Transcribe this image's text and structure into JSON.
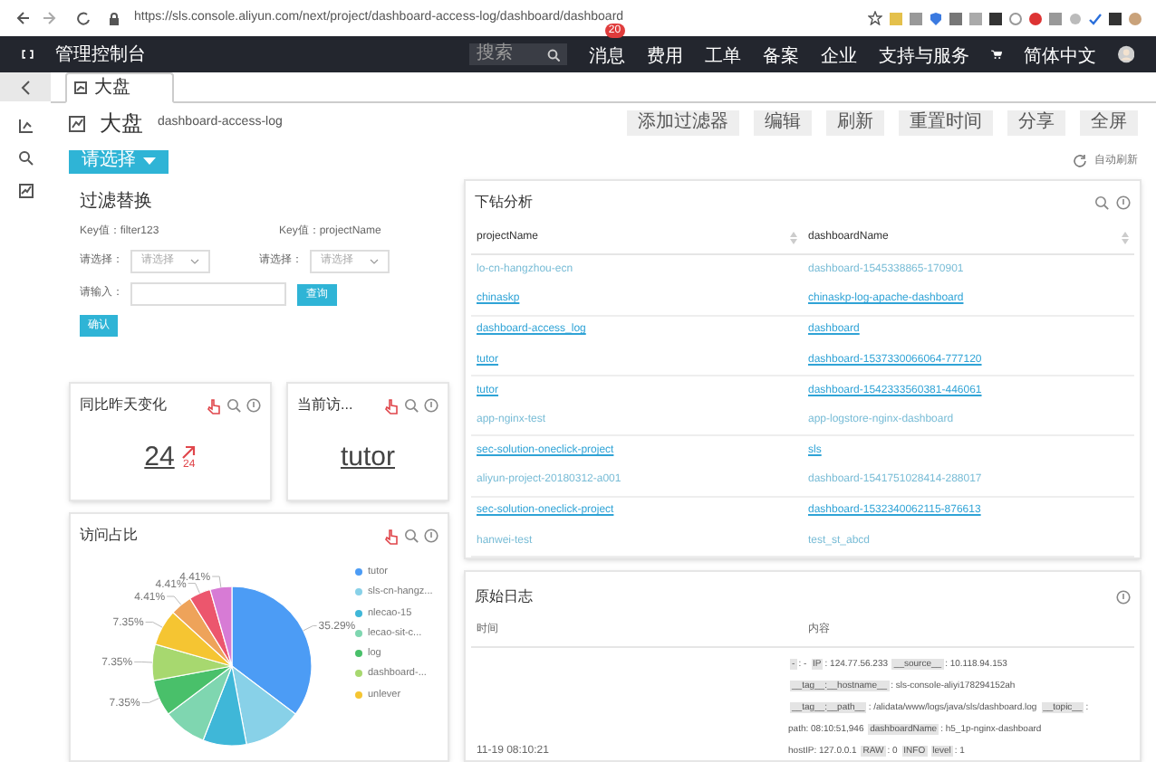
{
  "browser": {
    "url": "https://sls.console.aliyun.com/next/project/dashboard-access-log/dashboard/dashboard"
  },
  "topbar": {
    "title": "管理控制台",
    "search_placeholder": "搜索",
    "badge": "20",
    "nav": [
      "消息",
      "费用",
      "工单",
      "备案",
      "企业",
      "支持与服务",
      "简体中文"
    ]
  },
  "tabs": [
    {
      "label": "大盘",
      "selected": true
    }
  ],
  "header": {
    "title": "大盘",
    "subtitle": "dashboard-access-log",
    "actions": [
      "添加过滤器",
      "编辑",
      "刷新",
      "重置时间",
      "分享",
      "全屏"
    ],
    "select_button": "请选择",
    "refresh": "自动刷新"
  },
  "filter": {
    "title": "过滤替换",
    "key1": "Key值：filter123",
    "key2": "Key值：projectName",
    "select_label1": "请选择：",
    "select_label2": "请选择：",
    "select_placeholder1": "请选择",
    "select_placeholder2": "请选择",
    "input_label": "请输入：",
    "query_button": "查询",
    "confirm_button": "确认"
  },
  "cards": [
    {
      "title": "同比昨天变化",
      "value": "24",
      "delta": "24"
    },
    {
      "title": "当前访...",
      "value": "tutor"
    }
  ],
  "pie": {
    "title": "访问占比",
    "chart_data": {
      "type": "pie",
      "categories": [
        "tutor",
        "sls-cn-hangz...",
        "nlecao-15",
        "lecao-sit-c...",
        "log",
        "dashboard-...",
        "unlever",
        null,
        null,
        null
      ],
      "series": [
        {
          "values": [
            35.29,
            11.76,
            8.82,
            8.82,
            7.35,
            7.35,
            7.35,
            4.41,
            4.41,
            4.41
          ]
        }
      ],
      "colors": [
        "#4c9cf5",
        "#88d1e8",
        "#3fb7d8",
        "#7fd6b0",
        "#49c06a",
        "#a7d86f",
        "#f5c532",
        "#eea35a",
        "#ec566d",
        "#d77bd5"
      ],
      "value_labels": [
        "35.29%",
        null,
        null,
        null,
        "7.35%",
        "7.35%",
        "7.35%",
        "4.41%",
        "4.41%",
        "4.41%"
      ],
      "legend": "right"
    }
  },
  "drill": {
    "title": "下钻分析",
    "columns": [
      "projectName",
      "dashboardName"
    ],
    "rows": [
      {
        "link": false,
        "cells": [
          "lo-cn-hangzhou-ecn",
          "dashboard-1545338865-170901"
        ]
      },
      {
        "link": true,
        "cells": [
          "chinaskp",
          "chinaskp-log-apache-dashboard"
        ]
      },
      {
        "link": true,
        "cells": [
          "dashboard-access_log",
          "dashboard"
        ]
      },
      {
        "link": true,
        "cells": [
          "tutor",
          "dashboard-1537330066064-777120"
        ]
      },
      {
        "link": true,
        "cells": [
          "tutor",
          "dashboard-1542333560381-446061"
        ]
      },
      {
        "link": false,
        "cells": [
          "app-nginx-test",
          "app-logstore-nginx-dashboard"
        ]
      },
      {
        "link": true,
        "cells": [
          "sec-solution-oneclick-project",
          "sls"
        ]
      },
      {
        "link": false,
        "cells": [
          "aliyun-project-20180312-a001",
          "dashboard-1541751028414-288017"
        ]
      },
      {
        "link": true,
        "cells": [
          "sec-solution-oneclick-project",
          "dashboard-1532340062115-876613"
        ]
      },
      {
        "link": false,
        "cells": [
          "hanwei-test",
          "test_st_abcd"
        ]
      }
    ]
  },
  "log": {
    "title": "原始日志",
    "columns": [
      "时间",
      "内容"
    ],
    "time": "11-19 08:10:21",
    "lines": [
      [
        {
          "kind": "key",
          "text": "-"
        },
        {
          "kind": "text",
          "text": ": - "
        },
        {
          "kind": "key",
          "text": "IP"
        },
        {
          "kind": "text",
          "text": ": 124.77.56.233 "
        },
        {
          "kind": "key",
          "text": "__source__"
        },
        {
          "kind": "text",
          "text": ": 10.118.94.153"
        }
      ],
      [
        {
          "kind": "key",
          "text": "__tag__:__hostname__"
        },
        {
          "kind": "text",
          "text": ": sls-console-aliyi178294152ah"
        }
      ],
      [
        {
          "kind": "key",
          "text": "__tag__:__path__"
        },
        {
          "kind": "text",
          "text": ": /alidata/www/logs/java/sls/dashboard.log "
        },
        {
          "kind": "key",
          "text": "__topic__"
        },
        {
          "kind": "text",
          "text": ":"
        }
      ],
      [
        {
          "kind": "text",
          "text": "path: 08:10:51,946 "
        },
        {
          "kind": "key",
          "text": "dashboardName"
        },
        {
          "kind": "text",
          "text": ": h5_1p-nginx-dashboard"
        }
      ],
      [
        {
          "kind": "text",
          "text": "hostIP: 127.0.0.1 "
        },
        {
          "kind": "key",
          "text": "RAW"
        },
        {
          "kind": "text",
          "text": ": 0 "
        },
        {
          "kind": "key",
          "text": "INFO"
        },
        {
          "kind": "key",
          "text": "level"
        },
        {
          "kind": "text",
          "text": ": 1"
        }
      ]
    ]
  }
}
